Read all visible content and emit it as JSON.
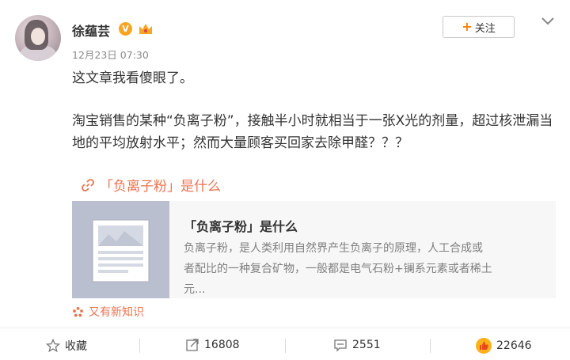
{
  "post": {
    "username": "徐蕴芸",
    "verified_badge": "V",
    "timestamp": "12月23日 07:30",
    "follow_label": "关注",
    "text_line1": "这文章我看傻眼了。",
    "text_para": "淘宝销售的某种“负离子粉”，接触半小时就相当于一张X光的剂量，超过核泄漏当地的平均放射水平；然而大量顾客买回家去除甲醛？？？",
    "link_text": "「负离子粉」是什么"
  },
  "card": {
    "title": "「负离子粉」是什么",
    "description": "负离子粉，是人类利用自然界产生负离子的原理，人工合成或者配比的一种复合矿物，一般都是电气石粉+镧系元素或者稀土元..."
  },
  "tag": {
    "label": "又有新知识"
  },
  "actions": {
    "favorite_label": "收藏",
    "repost_count": "16808",
    "comment_count": "2551",
    "like_count": "22646"
  },
  "colors": {
    "accent_orange": "#ff8200",
    "link_color": "#eb7350",
    "badge_color": "#f6a623",
    "card_bg": "#f7f7f7",
    "thumb_bg": "#b9bfcf"
  },
  "icons": {
    "link": "chain-link-icon",
    "tag": "sparkle-icon",
    "favorite": "star-icon",
    "repost": "share-icon",
    "comment": "comment-icon",
    "like": "thumbs-up-icon",
    "menu": "chevron-down-icon",
    "verified": "verified-v-icon",
    "crown": "crown-icon"
  }
}
